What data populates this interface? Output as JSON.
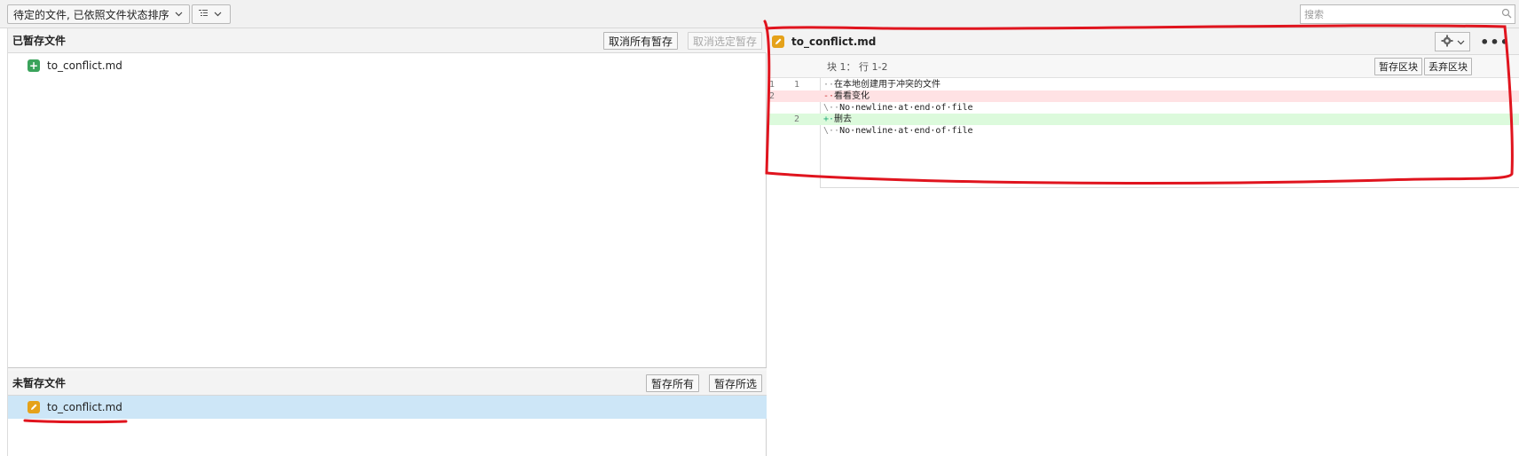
{
  "toolbar": {
    "filter_dropdown_label": "待定的文件, 已依照文件状态排序",
    "view_dropdown_icon": "list-view-icon",
    "search_placeholder": "搜索"
  },
  "staged": {
    "title": "已暂存文件",
    "unstage_all_label": "取消所有暂存",
    "unstage_selected_label": "取消选定暂存",
    "files": [
      {
        "name": "to_conflict.md",
        "status": "added"
      }
    ]
  },
  "unstaged": {
    "title": "未暂存文件",
    "stage_all_label": "暂存所有",
    "stage_selected_label": "暂存所选",
    "files": [
      {
        "name": "to_conflict.md",
        "status": "modified",
        "selected": true
      }
    ]
  },
  "diff": {
    "file_name": "to_conflict.md",
    "more_label": "•••",
    "hunk_label": "块 1： 行 1-2",
    "stage_hunk_label": "暂存区块",
    "discard_hunk_label": "丢弃区块",
    "lines": [
      {
        "old": "1",
        "new": "1",
        "type": "context",
        "sign": "··",
        "text": "在本地创建用于冲突的文件"
      },
      {
        "old": "2",
        "new": "",
        "type": "del",
        "sign": "-·",
        "text": "看看变化"
      },
      {
        "old": "",
        "new": "",
        "type": "context",
        "sign": "\\··",
        "text": "No·newline·at·end·of·file"
      },
      {
        "old": "",
        "new": "2",
        "type": "add",
        "sign": "+·",
        "text": "删去"
      },
      {
        "old": "",
        "new": "",
        "type": "context",
        "sign": "\\··",
        "text": "No·newline·at·end·of·file"
      }
    ]
  },
  "colors": {
    "added_badge": "#3aa35b",
    "modified_badge": "#e5a21a",
    "selected_row": "#cde6f7",
    "annotation": "#e0141e"
  }
}
